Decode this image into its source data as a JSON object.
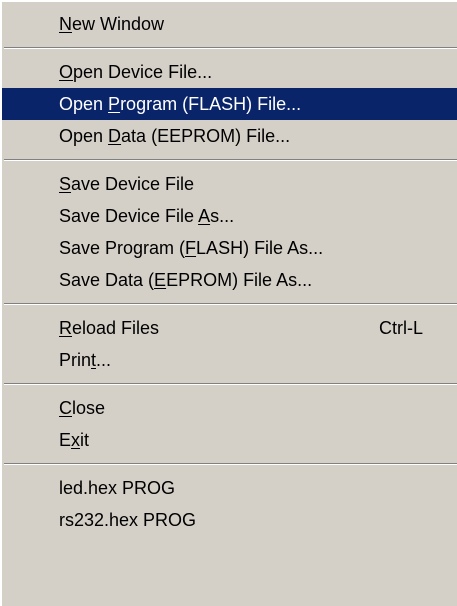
{
  "menu": {
    "groups": [
      {
        "items": [
          {
            "pre": "",
            "key": "N",
            "post": "ew Window",
            "shortcut": "",
            "highlighted": false
          }
        ]
      },
      {
        "items": [
          {
            "pre": "",
            "key": "O",
            "post": "pen Device File...",
            "shortcut": "",
            "highlighted": false
          },
          {
            "pre": "Open ",
            "key": "P",
            "post": "rogram (FLASH) File...",
            "shortcut": "",
            "highlighted": true
          },
          {
            "pre": "Open ",
            "key": "D",
            "post": "ata (EEPROM) File...",
            "shortcut": "",
            "highlighted": false
          }
        ]
      },
      {
        "items": [
          {
            "pre": "",
            "key": "S",
            "post": "ave Device File",
            "shortcut": "",
            "highlighted": false
          },
          {
            "pre": "Save Device File ",
            "key": "A",
            "post": "s...",
            "shortcut": "",
            "highlighted": false
          },
          {
            "pre": "Save Program (",
            "key": "F",
            "post": "LASH) File As...",
            "shortcut": "",
            "highlighted": false
          },
          {
            "pre": "Save Data (",
            "key": "E",
            "post": "EPROM) File As...",
            "shortcut": "",
            "highlighted": false
          }
        ]
      },
      {
        "items": [
          {
            "pre": "",
            "key": "R",
            "post": "eload Files",
            "shortcut": "Ctrl-L",
            "highlighted": false
          },
          {
            "pre": "Prin",
            "key": "t",
            "post": "...",
            "shortcut": "",
            "highlighted": false
          }
        ]
      },
      {
        "items": [
          {
            "pre": "",
            "key": "C",
            "post": "lose",
            "shortcut": "",
            "highlighted": false
          },
          {
            "pre": "E",
            "key": "x",
            "post": "it",
            "shortcut": "",
            "highlighted": false
          }
        ]
      },
      {
        "items": [
          {
            "pre": "led.hex PROG",
            "key": "",
            "post": "",
            "shortcut": "",
            "highlighted": false
          },
          {
            "pre": "rs232.hex PROG",
            "key": "",
            "post": "",
            "shortcut": "",
            "highlighted": false
          }
        ]
      }
    ]
  },
  "colors": {
    "menu_bg": "#d4d0c8",
    "highlight_bg": "#0a246a",
    "highlight_text": "#ffffff",
    "text": "#000000"
  }
}
